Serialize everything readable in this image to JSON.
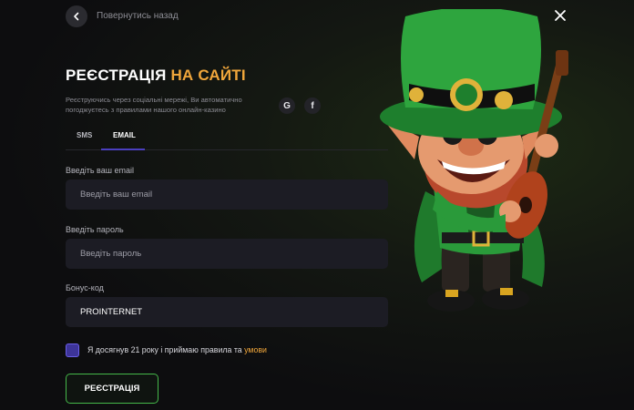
{
  "nav": {
    "back_label": "Повернутись назад"
  },
  "title": {
    "main": "РЕЄСТРАЦІЯ",
    "accent": "НА САЙТІ"
  },
  "subtitle": "Реєструючись через соціальні мережі, Ви автоматично погоджуєтесь з правилами нашого онлайн-казино",
  "social": {
    "google_letter": "G",
    "facebook_letter": "f"
  },
  "tabs": [
    {
      "label": "SMS",
      "active": false
    },
    {
      "label": "EMAIL",
      "active": true
    }
  ],
  "form": {
    "email": {
      "label": "Введіть ваш email",
      "placeholder": "Введіть ваш email",
      "value": ""
    },
    "password": {
      "label": "Введіть пароль",
      "placeholder": "Введіть пароль",
      "value": ""
    },
    "bonus": {
      "label": "Бонус-код",
      "placeholder": "",
      "value": "PROINTERNET"
    }
  },
  "agreement": {
    "checked": true,
    "text": "Я досягнув 21 року і приймаю правила та",
    "link": "умови"
  },
  "submit_label": "РЕЄСТРАЦІЯ",
  "colors": {
    "accent_orange": "#f0a63b",
    "accent_purple": "#4b3fbf",
    "button_green": "#45b84a",
    "background": "#0d0d0f"
  }
}
